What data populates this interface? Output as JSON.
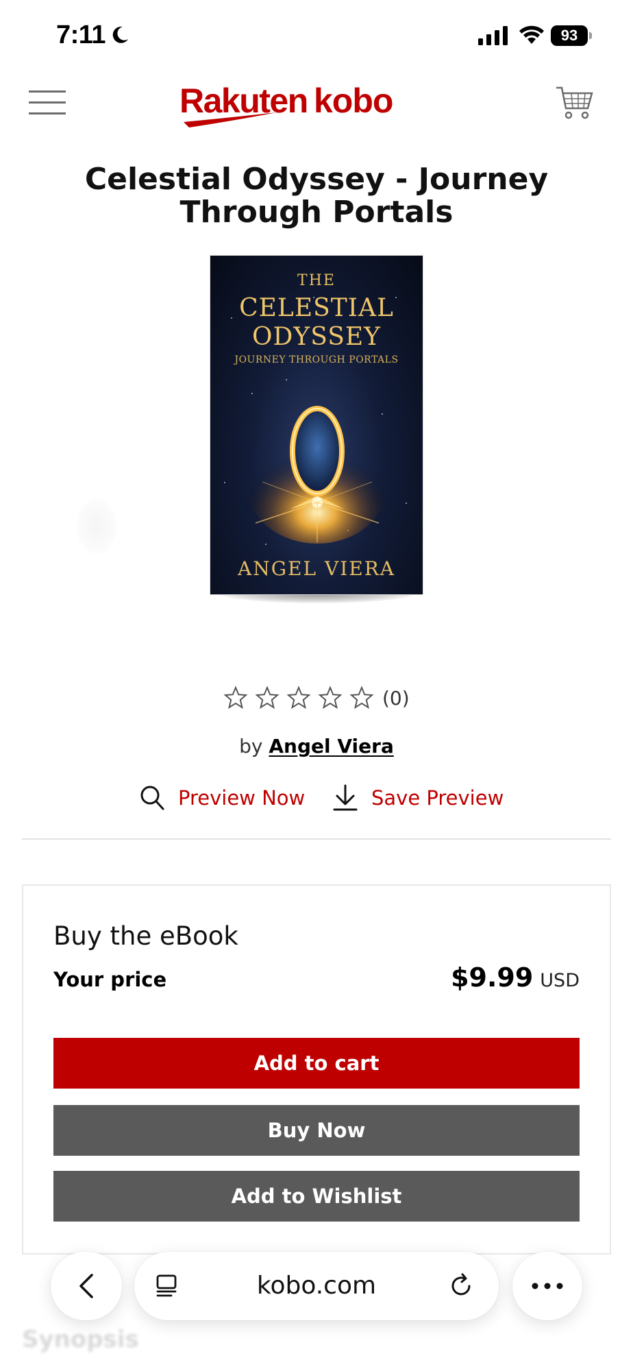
{
  "status_bar": {
    "time": "7:11",
    "battery": "93"
  },
  "header": {
    "logo_text": "Rakuten kobo",
    "brand_color": "#bf0000"
  },
  "book": {
    "title": "Celestial Odyssey - Journey Through Portals",
    "cover": {
      "line_the": "THE",
      "line_main_1": "CELESTIAL",
      "line_main_2": "ODYSSEY",
      "line_sub": "JOURNEY THROUGH PORTALS",
      "line_author": "ANGEL VIERA"
    },
    "rating": {
      "stars": 0,
      "max_stars": 5,
      "count_label": "(0)"
    },
    "byline_prefix": "by",
    "author": "Angel Viera"
  },
  "actions": {
    "preview_now": "Preview Now",
    "save_preview": "Save Preview"
  },
  "buy_box": {
    "heading": "Buy the eBook",
    "price_label": "Your price",
    "price_value": "$9.99",
    "price_currency": "USD",
    "add_to_cart": "Add to cart",
    "buy_now": "Buy Now",
    "add_to_wishlist": "Add to Wishlist"
  },
  "below_fold": {
    "section_heading": "Synopsis"
  },
  "browser": {
    "url": "kobo.com"
  },
  "icons": [
    "moon-icon",
    "cellular-signal-icon",
    "wifi-icon",
    "battery-icon",
    "hamburger-menu-icon",
    "cart-icon",
    "star-outline-icon",
    "search-icon",
    "download-icon",
    "back-arrow-icon",
    "tab-list-icon",
    "reload-icon",
    "more-icon"
  ]
}
